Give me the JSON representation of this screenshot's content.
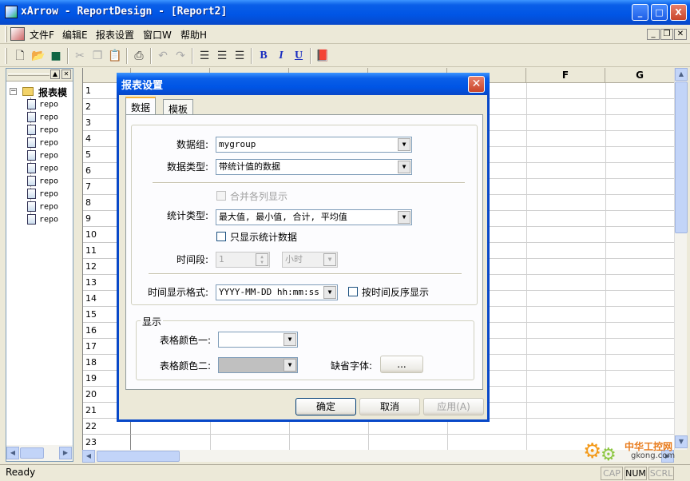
{
  "window": {
    "title": "xArrow - ReportDesign - [Report2]",
    "min": "_",
    "max": "□",
    "close": "X"
  },
  "menu": [
    {
      "label": "文件F"
    },
    {
      "label": "编辑E"
    },
    {
      "label": "报表设置"
    },
    {
      "label": "窗口W"
    },
    {
      "label": "帮助H"
    }
  ],
  "toolbar": {
    "bold": "B",
    "italic": "I",
    "underline": "U"
  },
  "tree": {
    "root": "报表模",
    "items": [
      "repo",
      "repo",
      "repo",
      "repo",
      "repo",
      "repo",
      "repo",
      "repo",
      "repo",
      "repo"
    ]
  },
  "grid": {
    "columns": [
      "F",
      "G"
    ],
    "rows": [
      "1",
      "2",
      "3",
      "4",
      "5",
      "6",
      "7",
      "8",
      "9",
      "10",
      "11",
      "12",
      "13",
      "14",
      "15",
      "16",
      "17",
      "18",
      "19",
      "20",
      "21",
      "22",
      "23"
    ]
  },
  "dialog": {
    "title": "报表设置",
    "tabs": [
      "数据",
      "模板"
    ],
    "data_group_label": "数据组:",
    "data_group_value": "mygroup",
    "data_type_label": "数据类型:",
    "data_type_value": "带统计值的数据",
    "merge_label": "合并各列显示",
    "stat_type_label": "统计类型:",
    "stat_type_value": "最大值, 最小值, 合计, 平均值",
    "only_stat_label": "只显示统计数据",
    "time_period_label": "时间段:",
    "time_period_value": "1",
    "time_unit_value": "小时",
    "time_format_label": "时间显示格式:",
    "time_format_value": "YYYY-MM-DD hh:mm:ss",
    "reverse_label": "按时间反序显示",
    "display_group": "显示",
    "color1_label": "表格颜色一:",
    "color2_label": "表格颜色二:",
    "font_label": "缺省字体:",
    "font_button": "...",
    "ok": "确定",
    "cancel": "取消",
    "apply": "应用(A)"
  },
  "status": {
    "text": "Ready",
    "cap": "CAP",
    "num": "NUM",
    "scrl": "SCRL"
  },
  "watermark": {
    "name": "中华工控网",
    "url": "gkong.com"
  }
}
